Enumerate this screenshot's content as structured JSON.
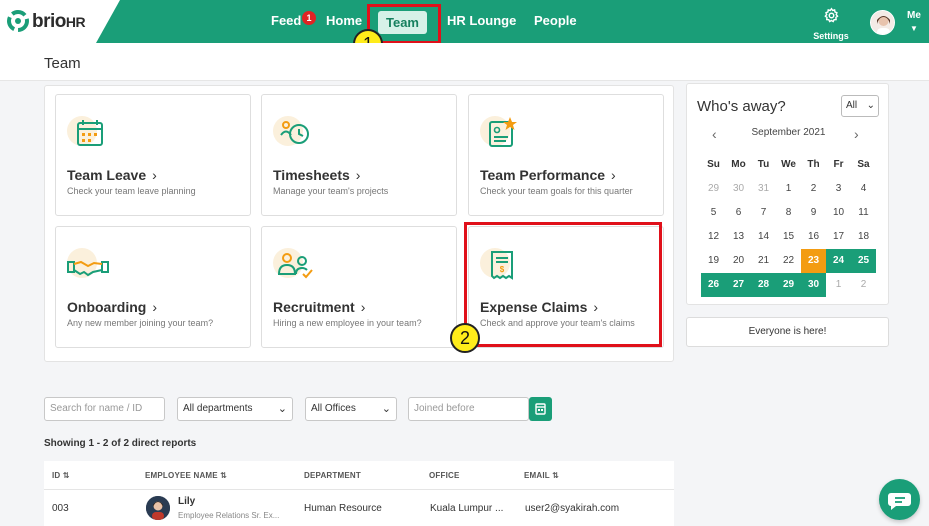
{
  "brand": {
    "name": "brio",
    "suffix": "HR"
  },
  "nav": {
    "feed": "Feed",
    "feed_badge": "1",
    "home": "Home",
    "team": "Team",
    "hr_lounge": "HR Lounge",
    "people": "People",
    "settings": "Settings",
    "me": "Me"
  },
  "callouts": {
    "one": "1",
    "two": "2"
  },
  "page": {
    "title": "Team"
  },
  "cards": [
    {
      "title": "Team Leave",
      "sub": "Check your team leave planning",
      "icon": "calendar-icon"
    },
    {
      "title": "Timesheets",
      "sub": "Manage your team's projects",
      "icon": "clock-person-icon"
    },
    {
      "title": "Team Performance",
      "sub": "Check your team goals for this quarter",
      "icon": "performance-icon"
    },
    {
      "title": "Onboarding",
      "sub": "Any new member joining your team?",
      "icon": "handshake-icon"
    },
    {
      "title": "Recruitment",
      "sub": "Hiring a new employee in your team?",
      "icon": "recruitment-icon"
    },
    {
      "title": "Expense Claims",
      "sub": "Check and approve your team's claims",
      "icon": "receipt-icon"
    }
  ],
  "away": {
    "title": "Who's away?",
    "filter": "All",
    "month": "September 2021",
    "weekdays": [
      "Su",
      "Mo",
      "Tu",
      "We",
      "Th",
      "Fr",
      "Sa"
    ],
    "weeks": [
      [
        "29",
        "30",
        "31",
        "1",
        "2",
        "3",
        "4"
      ],
      [
        "5",
        "6",
        "7",
        "8",
        "9",
        "10",
        "11"
      ],
      [
        "12",
        "13",
        "14",
        "15",
        "16",
        "17",
        "18"
      ],
      [
        "19",
        "20",
        "21",
        "22",
        "23",
        "24",
        "25"
      ],
      [
        "26",
        "27",
        "28",
        "29",
        "30",
        "1",
        "2"
      ]
    ],
    "everyone": "Everyone is here!",
    "colors": {
      "today": "#f39c12",
      "away": "#1a9e78"
    }
  },
  "filters": {
    "search_placeholder": "Search for name / ID",
    "department": "All departments",
    "office": "All Offices",
    "joined_placeholder": "Joined before"
  },
  "table": {
    "showing": "Showing 1 - 2 of 2 direct reports",
    "headers": {
      "id": "ID",
      "name": "EMPLOYEE NAME",
      "department": "DEPARTMENT",
      "office": "OFFICE",
      "email": "EMAIL"
    },
    "rows": [
      {
        "id": "003",
        "name": "Lily",
        "role": "Employee Relations Sr. Ex...",
        "department": "Human Resource",
        "office": "Kuala Lumpur ...",
        "email": "user2@syakirah.com"
      }
    ]
  },
  "theme": {
    "accent": "#1a9e78",
    "highlight": "#e0101a"
  }
}
